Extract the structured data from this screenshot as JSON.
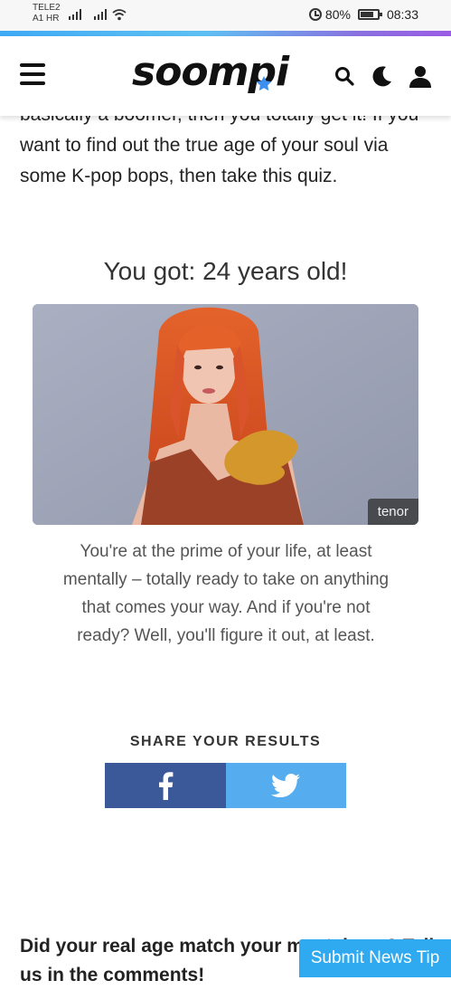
{
  "status_bar": {
    "carrier_line1": "TELE2",
    "carrier_line2": "A1 HR",
    "battery_percent": "80%",
    "battery_level": 0.8,
    "time": "08:33",
    "icons": [
      "signal-icon",
      "signal-icon",
      "wifi-icon",
      "alarm-icon",
      "battery-icon"
    ]
  },
  "header": {
    "logo_text": "soompi",
    "icons": [
      "menu-icon",
      "search-icon",
      "moon-icon",
      "user-icon"
    ]
  },
  "article": {
    "intro_text": "basically a boomer, then you totally get it! If you want to find out the true age of your soul via some K-pop bops, then take this quiz.",
    "result_title": "You got: 24 years old!",
    "image_badge": "tenor",
    "result_description": "You're at the prime of your life, at least mentally – totally ready to take on anything that comes your way. And if you're not ready? Well, you'll figure it out, at least.",
    "share_heading": "SHARE YOUR RESULTS",
    "share_buttons": [
      "facebook-icon",
      "twitter-icon"
    ],
    "bottom_question": "Did your real age match your mental age? Tell us in the comments!"
  },
  "submit_tip": {
    "label": "Submit News Tip"
  },
  "colors": {
    "facebook": "#3b5998",
    "twitter": "#55acee",
    "submit_tip": "#2fa9f0",
    "logo_star": "#3d8ff0"
  }
}
